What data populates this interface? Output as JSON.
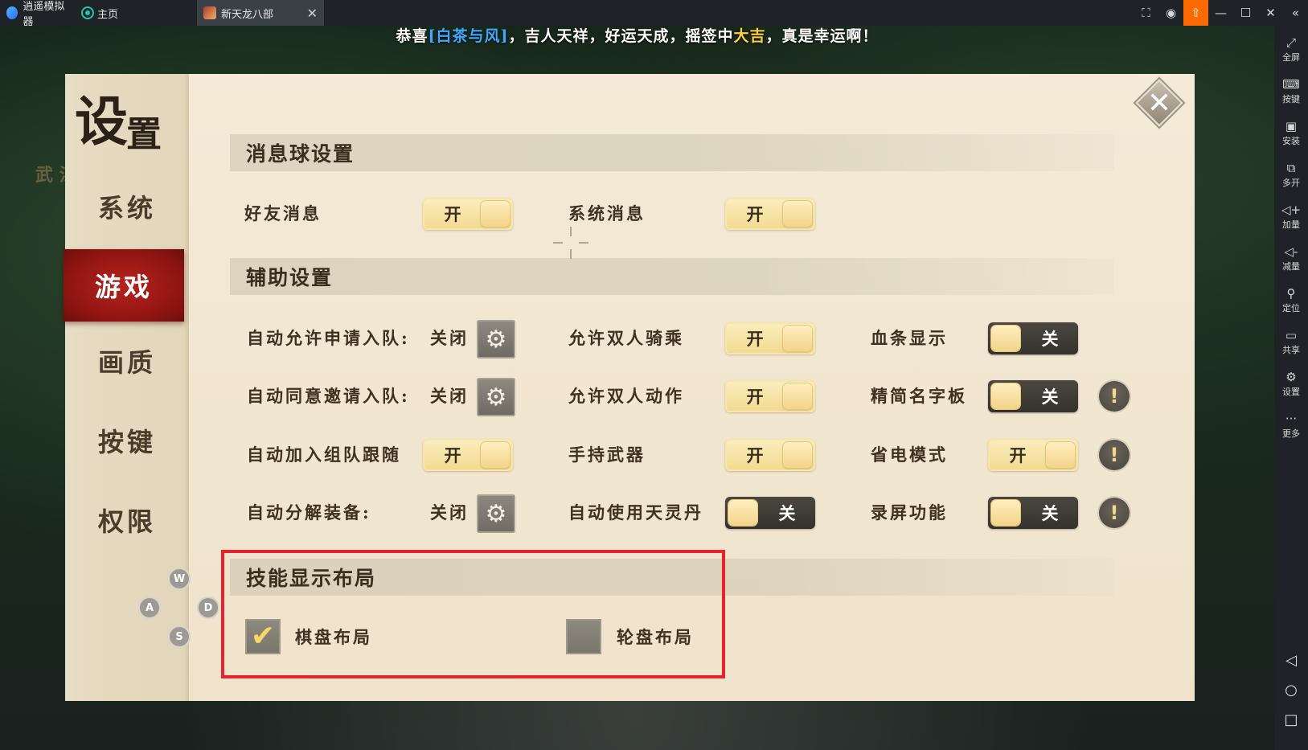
{
  "titlebar": {
    "app_name": "逍遥模拟器",
    "home_tab": "主页",
    "game_tab": "新天龙八部",
    "close_tab_glyph": "✕",
    "controls": [
      "⛶",
      "◉",
      "⇧",
      "—",
      "☐",
      "✕",
      "«"
    ],
    "accent_color": "#ff6a00"
  },
  "banner": {
    "prefix": "恭喜",
    "player": "[白茶与风]",
    "middle": "，吉人天祥，好运天成，摇签中",
    "result": "大吉",
    "suffix": "，真是幸运啊！"
  },
  "background": {
    "side_text": "武 江"
  },
  "right_sidebar": {
    "items": [
      {
        "icon": "⤢",
        "label": "全屏"
      },
      {
        "icon": "⌨",
        "label": "按键"
      },
      {
        "icon": "▣",
        "label": "安装"
      },
      {
        "icon": "⧉",
        "label": "多开"
      },
      {
        "icon": "◁+",
        "label": "加量"
      },
      {
        "icon": "◁-",
        "label": "减量"
      },
      {
        "icon": "⚲",
        "label": "定位"
      },
      {
        "icon": "▭",
        "label": "共享"
      },
      {
        "icon": "⚙",
        "label": "设置"
      },
      {
        "icon": "···",
        "label": "更多"
      }
    ],
    "nav": [
      "◁",
      "○",
      "□"
    ]
  },
  "panel": {
    "title_big": "设",
    "title_small": "置",
    "close_glyph": "✕",
    "nav": [
      {
        "label": "系统"
      },
      {
        "label": "游戏"
      },
      {
        "label": "画质"
      },
      {
        "label": "按键"
      },
      {
        "label": "权限"
      }
    ]
  },
  "sections": {
    "message_ball": {
      "title": "消息球设置",
      "friend_msg": {
        "label": "好友消息",
        "state": "开"
      },
      "system_msg": {
        "label": "系统消息",
        "state": "开"
      }
    },
    "assist": {
      "title": "辅助设置",
      "auto_allow_team": {
        "label": "自动允许申请入队:",
        "state": "关闭"
      },
      "auto_accept_invite": {
        "label": "自动同意邀请入队:",
        "state": "关闭"
      },
      "auto_join_follow": {
        "label": "自动加入组队跟随",
        "state": "开"
      },
      "auto_decompose": {
        "label": "自动分解装备:",
        "state": "关闭"
      },
      "allow_double_ride": {
        "label": "允许双人骑乘",
        "state": "开"
      },
      "allow_double_action": {
        "label": "允许双人动作",
        "state": "开"
      },
      "hold_weapon": {
        "label": "手持武器",
        "state": "开"
      },
      "auto_use_pill": {
        "label": "自动使用天灵丹",
        "state": "关"
      },
      "hp_bar": {
        "label": "血条显示",
        "state": "关"
      },
      "simple_nameplate": {
        "label": "精简名字板",
        "state": "关"
      },
      "power_save": {
        "label": "省电模式",
        "state": "开"
      },
      "screen_record": {
        "label": "录屏功能",
        "state": "关"
      },
      "warn_glyph": "!",
      "gear_glyph": "⚙"
    },
    "skill_layout": {
      "title": "技能显示布局",
      "grid_layout": {
        "label": "棋盘布局",
        "checked": true
      },
      "wheel_layout": {
        "label": "轮盘布局",
        "checked": false
      },
      "check_glyph": "✔"
    }
  },
  "keymap": {
    "w": "W",
    "a": "A",
    "s": "S",
    "d": "D"
  },
  "colors": {
    "active_nav": "#b8231e",
    "highlight_box": "#e8232b",
    "toggle_on": "#f1d98f",
    "toggle_off": "#35322d"
  }
}
